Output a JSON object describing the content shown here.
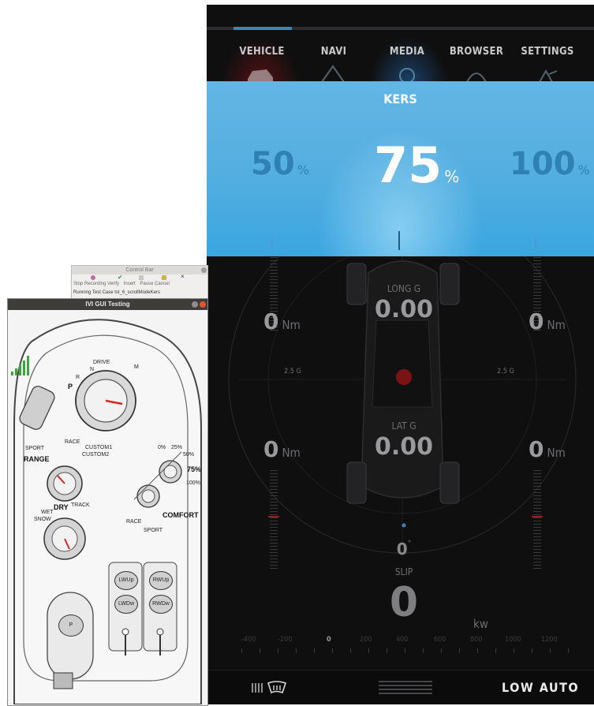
{
  "ivi": {
    "nav": [
      {
        "label": "VEHICLE",
        "icon": "car-icon"
      },
      {
        "label": "NAVI",
        "icon": "navigation-icon"
      },
      {
        "label": "MEDIA",
        "icon": "media-icon"
      },
      {
        "label": "BROWSER",
        "icon": "browser-icon"
      },
      {
        "label": "SETTINGS",
        "icon": "settings-icon"
      }
    ],
    "kers": {
      "title": "KERS",
      "left_value": "50",
      "center_value": "75",
      "right_value": "100",
      "unit": "%"
    },
    "gauges": {
      "long_g_label": "LONG G",
      "long_g_value": "0.00",
      "lat_g_label": "LAT G",
      "lat_g_value": "0.00",
      "torque_top_left": "0",
      "torque_top_right": "0",
      "torque_bottom_left": "0",
      "torque_bottom_right": "0",
      "torque_unit": "Nm",
      "g_ring_left": "2.5 G",
      "g_ring_right": "2.5 G",
      "slip_value": "0",
      "slip_degree": "°",
      "slip_label": "SLIP",
      "power_value": "0",
      "power_unit": "kw"
    },
    "power_scale": [
      "-400",
      "-200",
      "0",
      "200",
      "400",
      "600",
      "800",
      "1000",
      "1200"
    ],
    "bottom": {
      "climate_label": "LOW AUTO"
    },
    "colors": {
      "kers_bg": "#53aee0",
      "accent": "#3a85b8"
    }
  },
  "control_bar": {
    "title": "Control Bar",
    "buttons": [
      "Stop Recording",
      "Verify",
      "Insert",
      "Pause",
      "Cancel"
    ],
    "status": "Running Test Case tst_6_scrollModeKers"
  },
  "gui_window": {
    "title": "IVI GUI Testing",
    "gear_labels": [
      "P",
      "R",
      "N",
      "DRIVE",
      "M"
    ],
    "mode_labels": [
      "RACE",
      "CUSTOM1",
      "CUSTOM2",
      "SPORT",
      "RANGE"
    ],
    "surface_labels": [
      "DRY",
      "TRACK",
      "WET",
      "SNOW"
    ],
    "kers_labels": [
      "0%",
      "25%",
      "50%",
      "75%",
      "100%"
    ],
    "suspension_labels": [
      "COMFORT",
      "RACE",
      "SPORT"
    ],
    "window_buttons": [
      "LWUp",
      "RWUp",
      "LWDw",
      "RWDw"
    ],
    "park_button": "P"
  }
}
